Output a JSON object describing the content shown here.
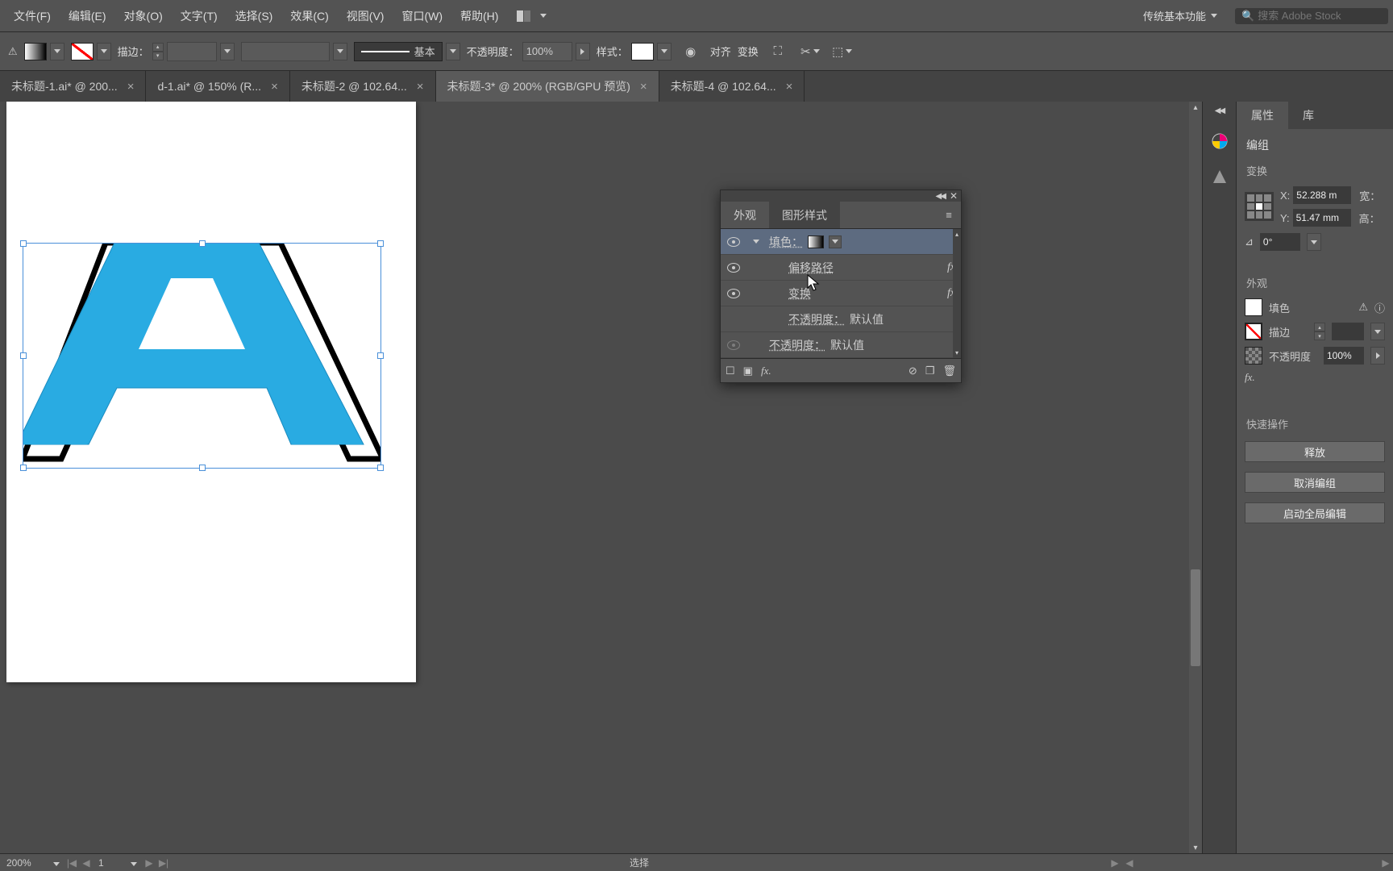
{
  "menubar": {
    "items": [
      "文件(F)",
      "编辑(E)",
      "对象(O)",
      "文字(T)",
      "选择(S)",
      "效果(C)",
      "视图(V)",
      "窗口(W)",
      "帮助(H)"
    ],
    "workspace": "传统基本功能",
    "search_placeholder": "搜索 Adobe Stock"
  },
  "controlbar": {
    "stroke_label": "描边：",
    "stroke_value": "",
    "style_name": "基本",
    "opacity_label": "不透明度：",
    "opacity_value": "100%",
    "style_label": "样式：",
    "align_label": "对齐",
    "transform_label": "变换"
  },
  "tabs": [
    {
      "label": "未标题-1.ai* @ 200...",
      "active": false
    },
    {
      "label": "d-1.ai* @ 150% (R...",
      "active": false
    },
    {
      "label": "未标题-2 @ 102.64...",
      "active": false
    },
    {
      "label": "未标题-3* @ 200% (RGB/GPU 预览)",
      "active": true
    },
    {
      "label": "未标题-4 @ 102.64...",
      "active": false
    }
  ],
  "appearance_panel": {
    "tab1": "外观",
    "tab2": "图形样式",
    "rows": [
      {
        "label_prefix": "填色：",
        "label_suffix": "",
        "hasSwatch": true,
        "fx": false,
        "selected": true,
        "eye": true,
        "toggle": true
      },
      {
        "label": "偏移路径",
        "fx": true,
        "eye": true,
        "indent": true
      },
      {
        "label": "变换",
        "fx": true,
        "eye": true,
        "indent": true
      },
      {
        "label_prefix": "不透明度：",
        "label_suffix": "默认值",
        "eye": false,
        "indent": true
      },
      {
        "label_prefix": "不透明度：",
        "label_suffix": "默认值",
        "eye": true,
        "dim": true
      }
    ]
  },
  "properties_panel": {
    "tab_props": "属性",
    "tab_lib": "库",
    "selection_type": "编组",
    "section_transform": "变换",
    "x_label": "X:",
    "x_value": "52.288 m",
    "y_label": "Y:",
    "y_value": "51.47 mm",
    "w_label": "宽：",
    "h_label": "高：",
    "rotation": "0°",
    "section_appearance": "外观",
    "fill_label": "填色",
    "stroke_label": "描边",
    "opacity_label": "不透明度",
    "opacity_value": "100%",
    "section_quick": "快速操作",
    "btn_release": "释放",
    "btn_ungroup": "取消编组",
    "btn_global_edit": "启动全局编辑"
  },
  "statusbar": {
    "zoom": "200%",
    "artboard_num": "1",
    "tool": "选择"
  }
}
